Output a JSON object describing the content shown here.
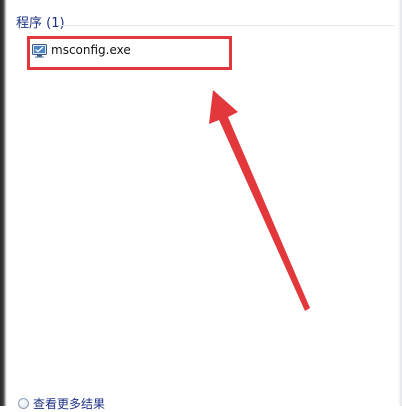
{
  "search_results": {
    "group_header": "程序 (1)",
    "items": [
      {
        "label": "msconfig.exe",
        "icon": "msconfig-icon"
      }
    ],
    "more_results_label": "查看更多结果"
  },
  "annotation": {
    "color": "#e2383b"
  }
}
